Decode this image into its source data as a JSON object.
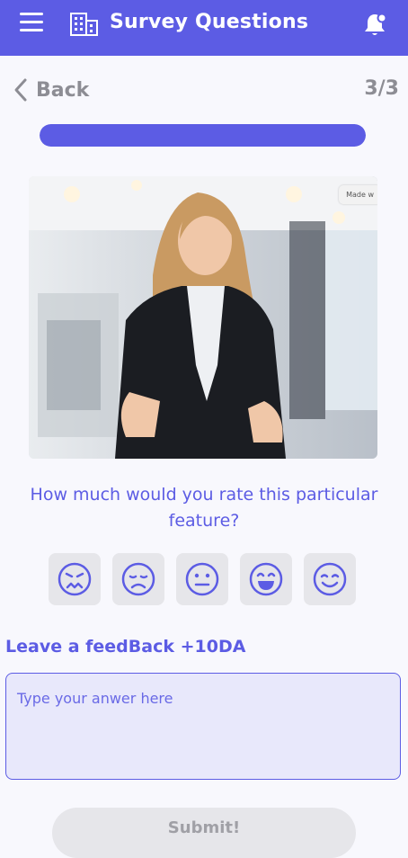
{
  "header": {
    "title": "Survey Questions",
    "menu_icon": "menu-icon",
    "app_icon": "building-icon",
    "notification_icon": "bell-icon"
  },
  "nav": {
    "back_label": "Back",
    "step": "3/3"
  },
  "progress": {
    "value": 1.0
  },
  "video": {
    "badge_text": "Made w"
  },
  "question": {
    "text": "How much would you rate this particular feature?"
  },
  "ratings": [
    {
      "icon": "angry-face-icon"
    },
    {
      "icon": "sad-face-icon"
    },
    {
      "icon": "neutral-face-icon"
    },
    {
      "icon": "happy-face-icon"
    },
    {
      "icon": "smiling-face-icon"
    }
  ],
  "feedback": {
    "label": "Leave a feedBack +10DA",
    "placeholder": "Type your anwer here"
  },
  "submit": {
    "label": "Submit!"
  },
  "colors": {
    "accent": "#5c5ce4",
    "muted": "#8d8d94",
    "button_bg": "#e6e6ea",
    "input_bg": "#e8e8fb"
  }
}
